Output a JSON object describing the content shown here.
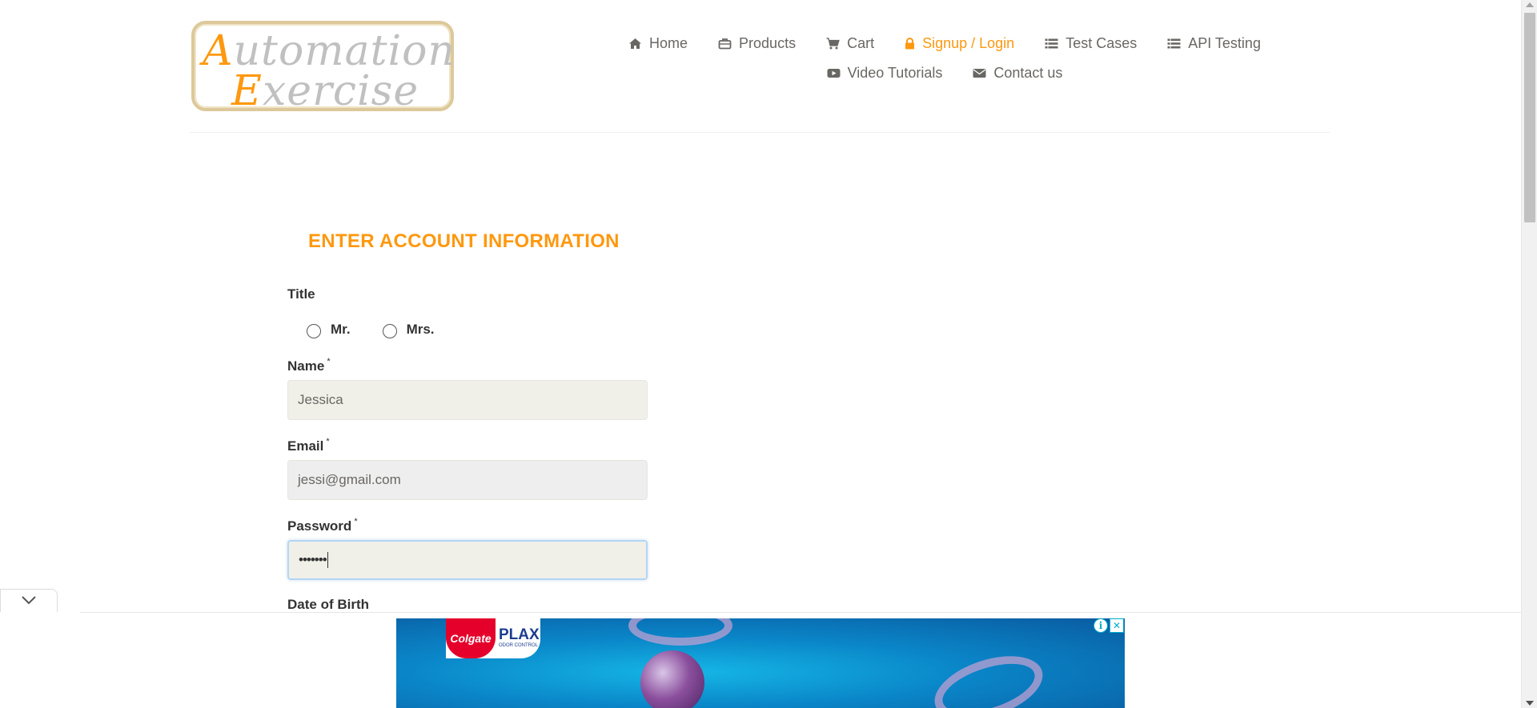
{
  "logo": {
    "line1_cap": "A",
    "line1_rest": "utomation",
    "line2_cap": "E",
    "line2_rest": "xercise"
  },
  "nav": {
    "row1": [
      {
        "id": "home",
        "label": "Home",
        "icon": "home-icon"
      },
      {
        "id": "products",
        "label": "Products",
        "icon": "briefcase-icon"
      },
      {
        "id": "cart",
        "label": "Cart",
        "icon": "cart-icon"
      },
      {
        "id": "signup-login",
        "label": "Signup / Login",
        "icon": "lock-icon",
        "active": true
      },
      {
        "id": "test-cases",
        "label": "Test Cases",
        "icon": "list-icon"
      },
      {
        "id": "api-testing",
        "label": "API Testing",
        "icon": "list-icon"
      }
    ],
    "row2": [
      {
        "id": "video-tutorials",
        "label": "Video Tutorials",
        "icon": "youtube-icon"
      },
      {
        "id": "contact-us",
        "label": "Contact us",
        "icon": "envelope-icon"
      }
    ]
  },
  "form": {
    "heading": "ENTER ACCOUNT INFORMATION",
    "title_label": "Title",
    "title_options": [
      "Mr.",
      "Mrs."
    ],
    "name_label": "Name",
    "name_value": "Jessica",
    "email_label": "Email",
    "email_value": "jessi@gmail.com",
    "password_label": "Password",
    "password_value": "•••••••",
    "dob_label": "Date of Birth",
    "required_mark": "*"
  },
  "ad": {
    "brand1": "Colgate",
    "brand2": "PLAX",
    "brand2_sub": "ODOR CONTROL",
    "info_glyph": "i",
    "close_glyph": "✕"
  },
  "colors": {
    "accent": "#fe980f",
    "text": "#696763",
    "input_bg": "#f0f0e9"
  }
}
